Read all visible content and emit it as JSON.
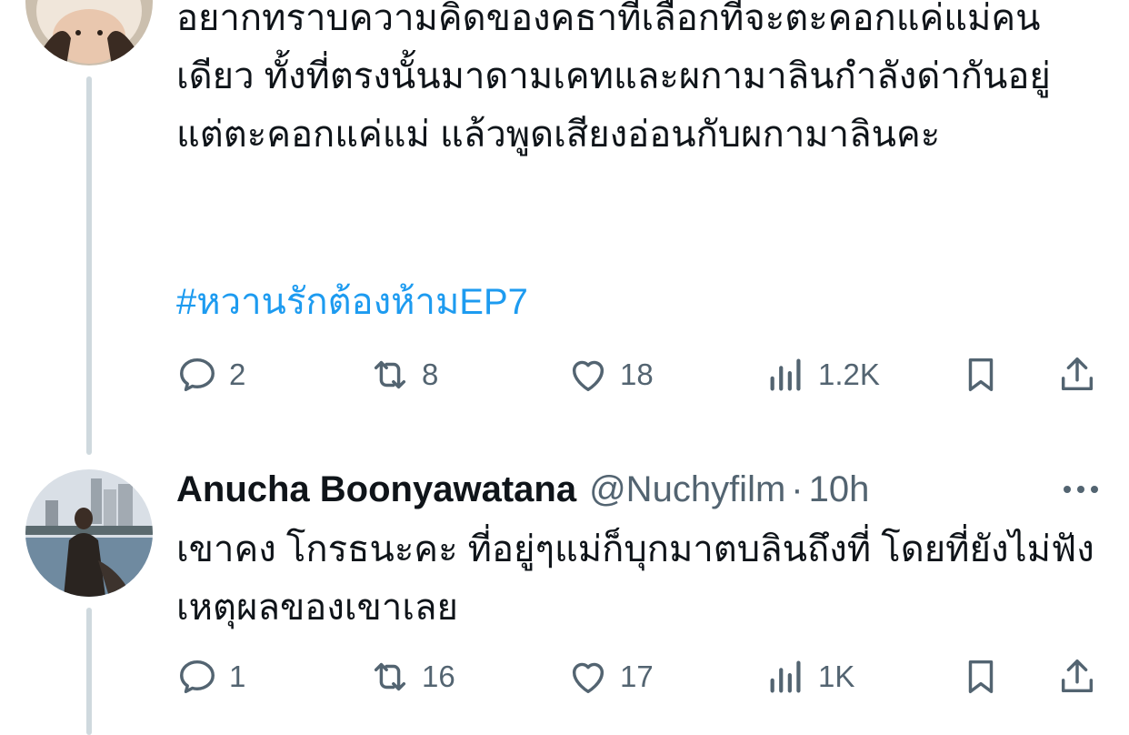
{
  "tweets": [
    {
      "text": "อยากทราบความคิดของคธาที่เลือกที่จะตะคอกแค่แม่คนเดียว ทั้งที่ตรงนั้นมาดามเคทและผกามาลินกำลังด่ากันอยู่ แต่ตะคอกแค่แม่ แล้วพูดเสียงอ่อนกับผกามาลินคะ",
      "hashtag": "#หวานรักต้องห้ามEP7",
      "actions": {
        "replies": "2",
        "reposts": "8",
        "likes": "18",
        "views": "1.2K"
      }
    },
    {
      "author_name": "Anucha Boonyawatana",
      "author_handle": "@Nuchyfilm",
      "separator": "·",
      "time": "10h",
      "text": "เขาคง โกรธนะคะ ที่อยู่ๆแม่ก็บุกมาตบลินถึงที่ โดยที่ยังไม่ฟังเหตุผลของเขาเลย",
      "actions": {
        "replies": "1",
        "reposts": "16",
        "likes": "17",
        "views": "1K"
      }
    }
  ],
  "icons": {
    "reply": "reply-icon",
    "repost": "repost-icon",
    "like": "heart-icon",
    "views": "views-icon",
    "bookmark": "bookmark-icon",
    "share": "share-icon",
    "more": "more-icon"
  },
  "colors": {
    "text": "#0f1419",
    "secondary": "#536471",
    "link": "#1d9bf0",
    "thread_line": "#cfd9de"
  }
}
